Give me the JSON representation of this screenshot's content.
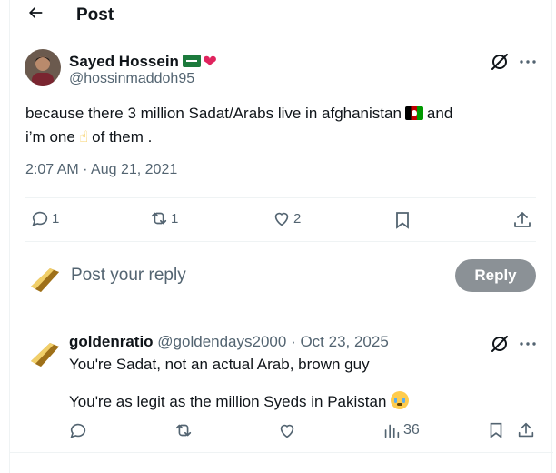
{
  "header": {
    "title": "Post"
  },
  "post": {
    "author_name": "Sayed Hossein",
    "author_handle": "@hossinmaddoh95",
    "text_part1": "because there 3 million Sadat/Arabs live in afghanistan",
    "text_part2": "and",
    "text_part3": "i’m one",
    "text_part4": "of them .",
    "timestamp": "2:07 AM · Aug 21, 2021",
    "stats": {
      "replies": "1",
      "reposts": "1",
      "likes": "2"
    }
  },
  "composer": {
    "placeholder": "Post your reply",
    "button_label": "Reply"
  },
  "reply": {
    "author_name": "goldenratio",
    "author_handle": "@goldendays2000",
    "date": " · Oct 23, 2025",
    "line1": "You're Sadat, not an actual Arab, brown guy",
    "line2": "You're as legit as the million Syeds in Pakistan",
    "views": "36"
  },
  "colors": {
    "muted": "#536471",
    "reply_button": "#8b9196",
    "heart": "#e0245e"
  }
}
